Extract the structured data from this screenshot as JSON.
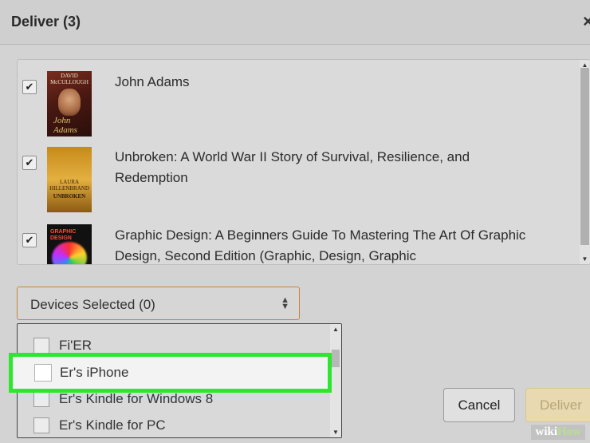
{
  "dialog": {
    "title": "Deliver (3)",
    "close_icon": "×"
  },
  "books": [
    {
      "title": "John Adams",
      "checked": true,
      "cover_text_top": "DAVID",
      "cover_text_bottom": "McCULLOUGH",
      "cover_signature": "John Adams"
    },
    {
      "title": "Unbroken: A World War II Story of Survival, Resilience, and Redemption",
      "checked": true,
      "cover_author": "LAURA HILLENBRAND",
      "cover_title": "UNBROKEN"
    },
    {
      "title": "Graphic Design: A Beginners Guide To Mastering The Art Of Graphic Design, Second Edition (Graphic, Design, Graphic",
      "checked": true,
      "cover_title": "GRAPHIC DESIGN"
    }
  ],
  "devices": {
    "select_label": "Devices Selected (0)",
    "options": [
      {
        "label": "Fi'ER",
        "checked": false
      },
      {
        "label": "Er's iPhone",
        "checked": false,
        "highlighted": true
      },
      {
        "label": "Er's Kindle for Windows 8",
        "checked": false
      },
      {
        "label": "Er's Kindle for PC",
        "checked": false
      }
    ]
  },
  "buttons": {
    "cancel": "Cancel",
    "deliver": "Deliver"
  },
  "watermark": {
    "wiki": "wiki",
    "how": "How"
  },
  "colors": {
    "highlight": "#2ee62e",
    "select_border": "#c8843a",
    "deliver_bg": "#e8d9b0"
  }
}
